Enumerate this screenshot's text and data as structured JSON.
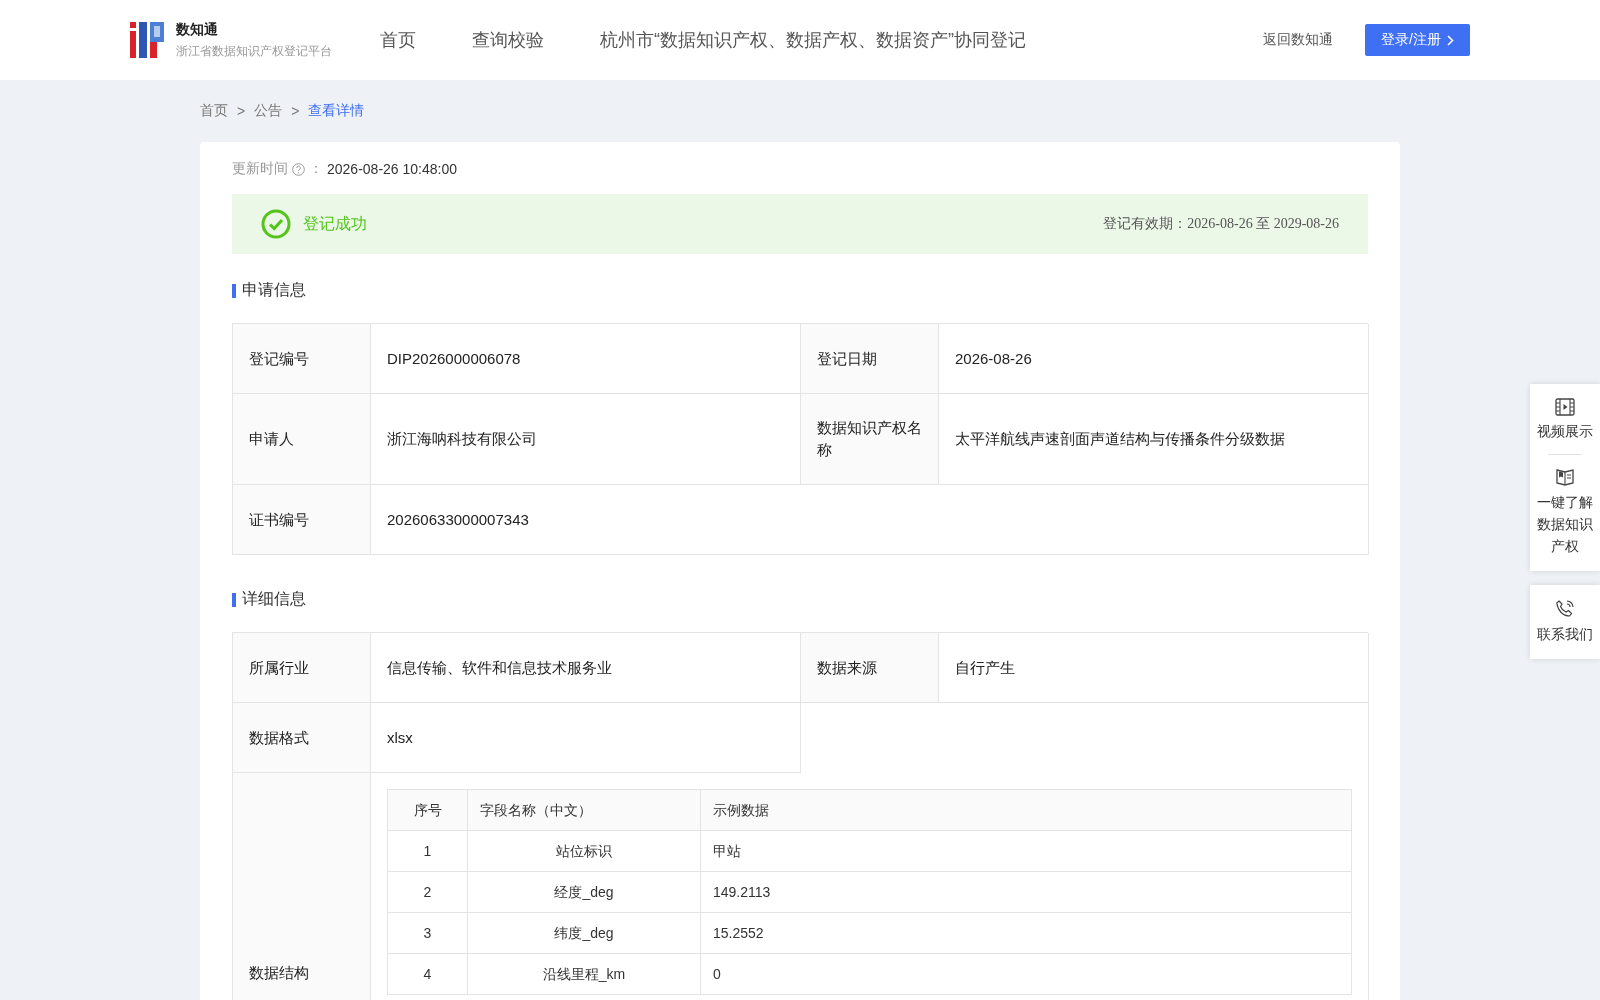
{
  "header": {
    "logo_title": "数知通",
    "logo_subtitle": "浙江省数据知识产权登记平台",
    "nav": [
      {
        "label": "首页"
      },
      {
        "label": "查询校验"
      },
      {
        "label": "杭州市“数据知识产权、数据产权、数据资产”协同登记"
      }
    ],
    "back_link": "返回数知通",
    "login_button": "登录/注册"
  },
  "breadcrumb": {
    "items": [
      {
        "label": "首页",
        "current": false
      },
      {
        "label": "公告",
        "current": false
      },
      {
        "label": "查看详情",
        "current": true
      }
    ],
    "separators": [
      ">",
      ">"
    ]
  },
  "update": {
    "label": "更新时间",
    "colon": "：",
    "value": "2026-08-26 10:48:00"
  },
  "status": {
    "success": true,
    "text": "登记成功",
    "validity": "登记有效期：2026-08-26 至 2029-08-26"
  },
  "sections": [
    {
      "title": "申请信息",
      "rows": [
        {
          "kind": "pair",
          "cells": [
            {
              "label": "登记编号",
              "value": "DIP2026000006078"
            },
            {
              "label": "登记日期",
              "value": "2026-08-26"
            }
          ]
        },
        {
          "kind": "pair",
          "cells": [
            {
              "label": "申请人",
              "value": "浙江海呐科技有限公司"
            },
            {
              "label": "数据知识产权名称",
              "value": "太平洋航线声速剖面声道结构与传播条件分级数据"
            }
          ]
        },
        {
          "kind": "wide",
          "cells": [
            {
              "label": "证书编号",
              "value": "20260633000007343"
            }
          ]
        }
      ]
    },
    {
      "title": "详细信息",
      "rows": [
        {
          "kind": "pair",
          "cells": [
            {
              "label": "所属行业",
              "value": "信息传输、软件和信息技术服务业"
            },
            {
              "label": "数据来源",
              "value": "自行产生"
            }
          ]
        },
        {
          "kind": "half",
          "cells": [
            {
              "label": "数据格式",
              "value": "xlsx"
            }
          ]
        },
        {
          "kind": "table",
          "label": "数据结构",
          "table": {
            "columns": [
              "序号",
              "字段名称（中文）",
              "示例数据"
            ],
            "rows": [
              [
                "1",
                "站位标识",
                "甲站"
              ],
              [
                "2",
                "经度_deg",
                "149.2113"
              ],
              [
                "3",
                "纬度_deg",
                "15.2552"
              ],
              [
                "4",
                "沿线里程_km",
                "0"
              ]
            ]
          }
        }
      ]
    }
  ],
  "float_panel": [
    {
      "items": [
        {
          "label": "视频展示"
        },
        {
          "label": "一键了解数据知识产权"
        }
      ]
    },
    {
      "items": [
        {
          "label": "联系我们"
        }
      ]
    }
  ]
}
